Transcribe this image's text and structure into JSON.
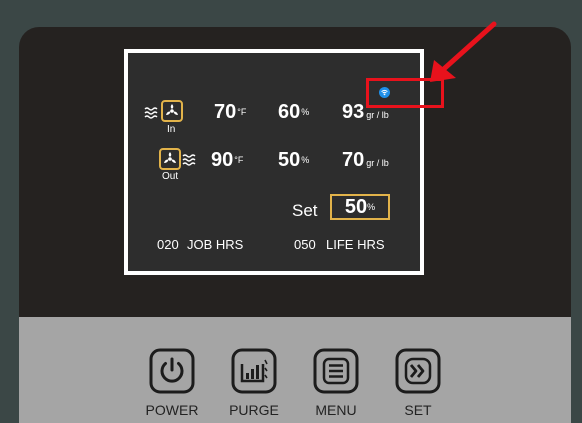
{
  "display": {
    "in_row": {
      "label": "In",
      "temperature": "70",
      "temperature_unit": "°F",
      "humidity": "60",
      "humidity_unit": "%",
      "grains": "93",
      "grains_unit": "gr / lb"
    },
    "out_row": {
      "label": "Out",
      "temperature": "90",
      "temperature_unit": "°F",
      "humidity": "50",
      "humidity_unit": "%",
      "grains": "70",
      "grains_unit": "gr / lb"
    },
    "set_label": "Set",
    "set_value": "50",
    "set_unit": "%",
    "job_hrs_value": "020",
    "job_hrs_label": "JOB HRS",
    "life_hrs_value": "050",
    "life_hrs_label": "LIFE HRS",
    "wifi_color": "#1e8fe8"
  },
  "annotation": {
    "color": "#e8121c"
  },
  "buttons": [
    {
      "label": "POWER",
      "icon": "power-icon"
    },
    {
      "label": "PURGE",
      "icon": "purge-icon"
    },
    {
      "label": "MENU",
      "icon": "menu-icon"
    },
    {
      "label": "SET",
      "icon": "double-chevron-right-icon"
    }
  ],
  "colors": {
    "accent": "#e2b34a",
    "screen_bg": "#2d2d2d",
    "panel_bg": "#a5a5a5",
    "device_bg": "#252220",
    "background": "#3b4746"
  }
}
